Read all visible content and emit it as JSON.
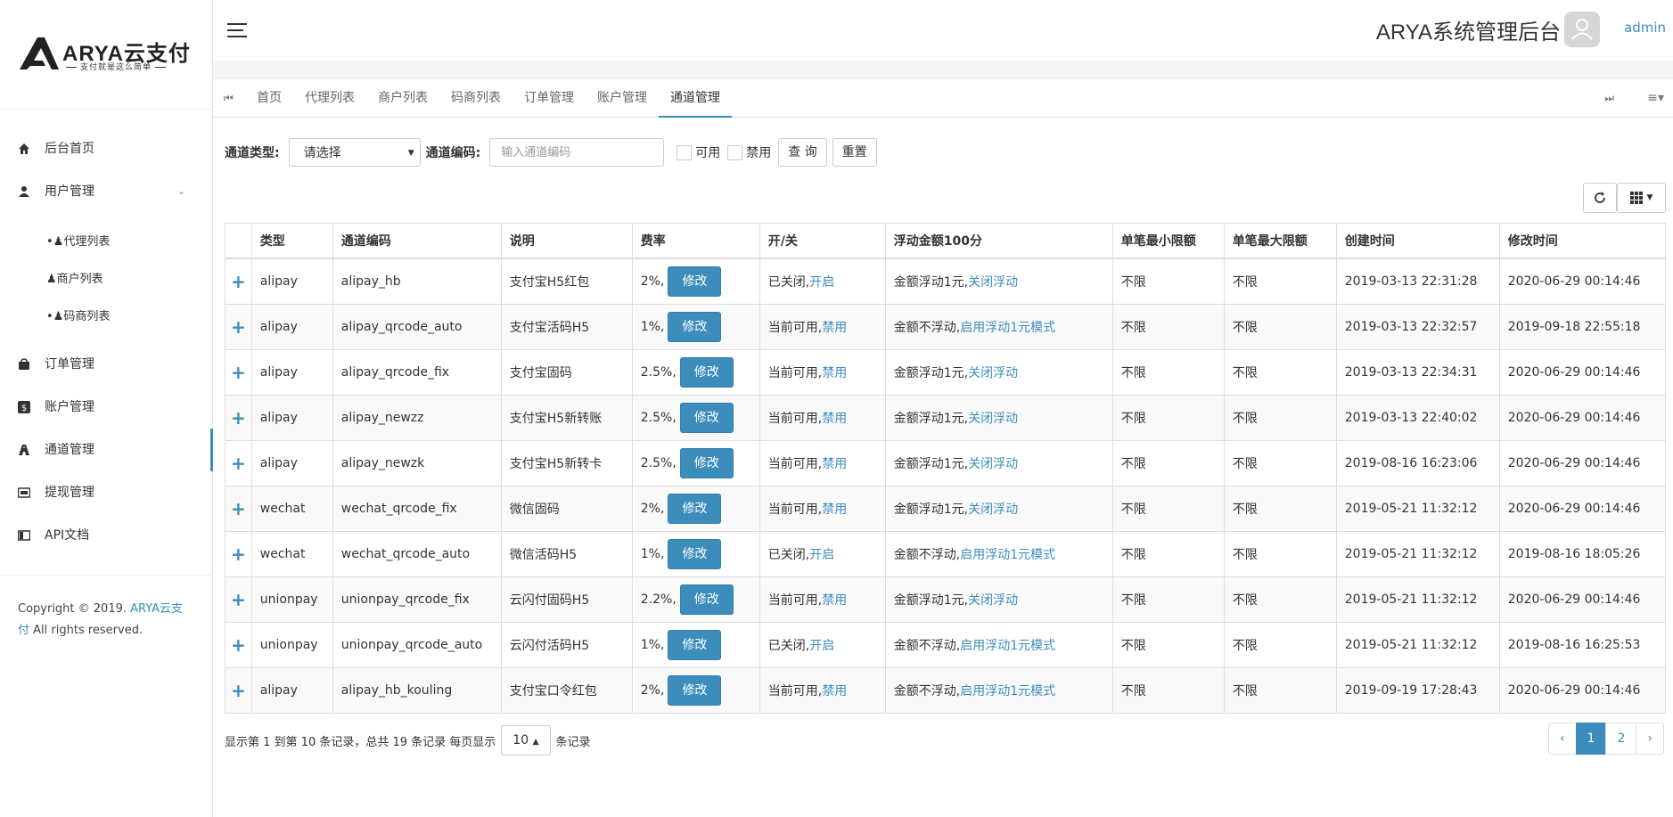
{
  "brand": {
    "logo_text": "ARYA云支付",
    "logo_slogan": "支付就是这么简单"
  },
  "sidebar": {
    "items": [
      {
        "label": "后台首页",
        "icon": "home-icon"
      },
      {
        "label": "用户管理",
        "icon": "user-icon"
      },
      {
        "label": "订单管理",
        "icon": "bag-icon"
      },
      {
        "label": "账户管理",
        "icon": "dollar-icon"
      },
      {
        "label": "通道管理",
        "icon": "road-icon"
      },
      {
        "label": "提现管理",
        "icon": "card-icon"
      },
      {
        "label": "API文档",
        "icon": "book-icon"
      }
    ],
    "subitems": [
      {
        "label": "代理列表"
      },
      {
        "label": "商户列表"
      },
      {
        "label": "码商列表"
      }
    ],
    "copyright_prefix": "Copyright © 2019. ",
    "copyright_brand": "ARYA云支付",
    "copyright_suffix": " All rights reserved."
  },
  "header": {
    "title": "ARYA系统管理后台",
    "username": "admin"
  },
  "tabs": [
    {
      "label": "首页"
    },
    {
      "label": "代理列表"
    },
    {
      "label": "商户列表"
    },
    {
      "label": "码商列表"
    },
    {
      "label": "订单管理"
    },
    {
      "label": "账户管理"
    },
    {
      "label": "通道管理"
    }
  ],
  "filter": {
    "type_label": "通道类型:",
    "type_value": "请选择",
    "code_label": "通道编码:",
    "code_placeholder": "输入通道编码",
    "available_label": "可用",
    "disabled_label": "禁用",
    "search_label": "查 询",
    "reset_label": "重置"
  },
  "table": {
    "headers": [
      "类型",
      "通道编码",
      "说明",
      "费率",
      "开/关",
      "浮动金额100分",
      "单笔最小限额",
      "单笔最大限额",
      "创建时间",
      "修改时间"
    ],
    "edit_label": "修改",
    "rows": [
      {
        "type": "alipay",
        "code": "alipay_hb",
        "desc": "支付宝H5红包",
        "rate": "2%,",
        "status": "已关闭,",
        "status_action": "开启",
        "float": "金额浮动1元,",
        "float_action": "关闭浮动",
        "min": "不限",
        "max": "不限",
        "created": "2019-03-13 22:31:28",
        "modified": "2020-06-29 00:14:46"
      },
      {
        "type": "alipay",
        "code": "alipay_qrcode_auto",
        "desc": "支付宝活码H5",
        "rate": "1%,",
        "status": "当前可用,",
        "status_action": "禁用",
        "float": "金额不浮动,",
        "float_action": "启用浮动1元模式",
        "min": "不限",
        "max": "不限",
        "created": "2019-03-13 22:32:57",
        "modified": "2019-09-18 22:55:18"
      },
      {
        "type": "alipay",
        "code": "alipay_qrcode_fix",
        "desc": "支付宝固码",
        "rate": "2.5%,",
        "status": "当前可用,",
        "status_action": "禁用",
        "float": "金额浮动1元,",
        "float_action": "关闭浮动",
        "min": "不限",
        "max": "不限",
        "created": "2019-03-13 22:34:31",
        "modified": "2020-06-29 00:14:46"
      },
      {
        "type": "alipay",
        "code": "alipay_newzz",
        "desc": "支付宝H5新转账",
        "rate": "2.5%,",
        "status": "当前可用,",
        "status_action": "禁用",
        "float": "金额浮动1元,",
        "float_action": "关闭浮动",
        "min": "不限",
        "max": "不限",
        "created": "2019-03-13 22:40:02",
        "modified": "2020-06-29 00:14:46"
      },
      {
        "type": "alipay",
        "code": "alipay_newzk",
        "desc": "支付宝H5新转卡",
        "rate": "2.5%,",
        "status": "当前可用,",
        "status_action": "禁用",
        "float": "金额浮动1元,",
        "float_action": "关闭浮动",
        "min": "不限",
        "max": "不限",
        "created": "2019-08-16 16:23:06",
        "modified": "2020-06-29 00:14:46"
      },
      {
        "type": "wechat",
        "code": "wechat_qrcode_fix",
        "desc": "微信固码",
        "rate": "2%,",
        "status": "当前可用,",
        "status_action": "禁用",
        "float": "金额浮动1元,",
        "float_action": "关闭浮动",
        "min": "不限",
        "max": "不限",
        "created": "2019-05-21 11:32:12",
        "modified": "2020-06-29 00:14:46"
      },
      {
        "type": "wechat",
        "code": "wechat_qrcode_auto",
        "desc": "微信活码H5",
        "rate": "1%,",
        "status": "已关闭,",
        "status_action": "开启",
        "float": "金额不浮动,",
        "float_action": "启用浮动1元模式",
        "min": "不限",
        "max": "不限",
        "created": "2019-05-21 11:32:12",
        "modified": "2019-08-16 18:05:26"
      },
      {
        "type": "unionpay",
        "code": "unionpay_qrcode_fix",
        "desc": "云闪付固码H5",
        "rate": "2.2%,",
        "status": "当前可用,",
        "status_action": "禁用",
        "float": "金额浮动1元,",
        "float_action": "关闭浮动",
        "min": "不限",
        "max": "不限",
        "created": "2019-05-21 11:32:12",
        "modified": "2020-06-29 00:14:46"
      },
      {
        "type": "unionpay",
        "code": "unionpay_qrcode_auto",
        "desc": "云闪付活码H5",
        "rate": "1%,",
        "status": "已关闭,",
        "status_action": "开启",
        "float": "金额不浮动,",
        "float_action": "启用浮动1元模式",
        "min": "不限",
        "max": "不限",
        "created": "2019-05-21 11:32:12",
        "modified": "2019-08-16 16:25:53"
      },
      {
        "type": "alipay",
        "code": "alipay_hb_kouling",
        "desc": "支付宝口令红包",
        "rate": "2%,",
        "status": "当前可用,",
        "status_action": "禁用",
        "float": "金额不浮动,",
        "float_action": "启用浮动1元模式",
        "min": "不限",
        "max": "不限",
        "created": "2019-09-19 17:28:43",
        "modified": "2020-06-29 00:14:46"
      }
    ]
  },
  "pagination": {
    "info_prefix": "显示第 1 到第 10 条记录，总共 19 条记录 每页显示",
    "page_size": "10",
    "info_suffix": "条记录",
    "prev": "‹",
    "pages": [
      "1",
      "2"
    ],
    "next": "›"
  },
  "colors": {
    "accent": "#3c8dbc"
  }
}
